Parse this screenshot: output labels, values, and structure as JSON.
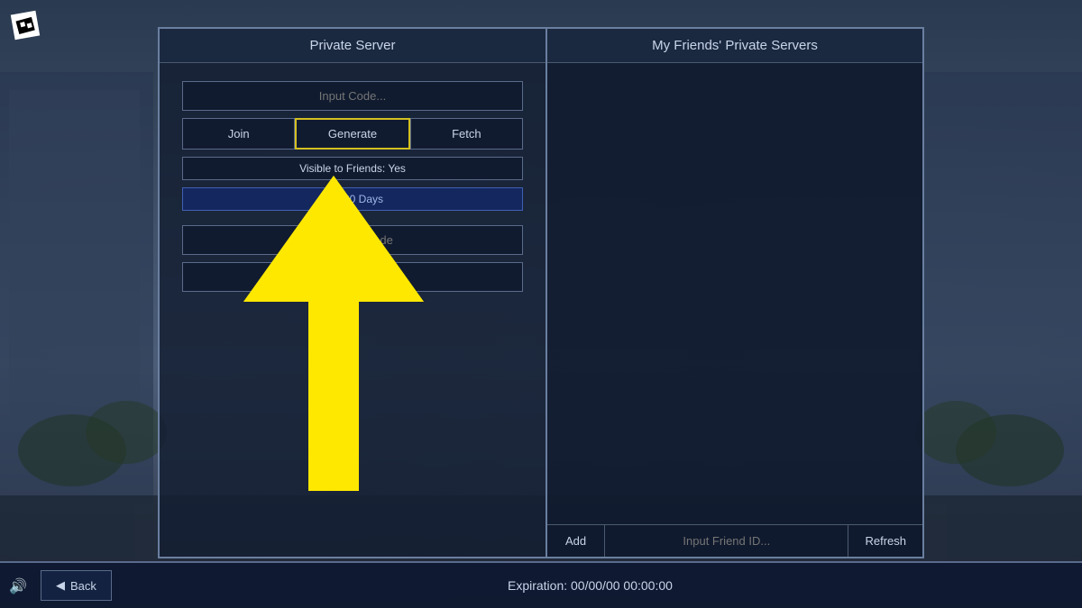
{
  "app": {
    "logo_text": "R",
    "background_color": "#1a2a3a"
  },
  "left_panel": {
    "title": "Private Server",
    "input_code_placeholder": "Input Code...",
    "join_label": "Join",
    "generate_label": "Generate",
    "fetch_label": "Fetch",
    "visible_friends_label": "Visible to Friends: Yes",
    "buy_days_label": "Buy 30 Days",
    "input_key_code_placeholder": "Input Key Code",
    "empty_field_placeholder": ""
  },
  "right_panel": {
    "title": "My Friends' Private Servers",
    "add_label": "Add",
    "friend_id_placeholder": "Input Friend ID...",
    "refresh_label": "Refresh"
  },
  "bottom_bar": {
    "back_label": "Back",
    "expiration_label": "Expiration: 00/00/00 00:00:00"
  },
  "arrow": {
    "color": "#FFE800"
  }
}
